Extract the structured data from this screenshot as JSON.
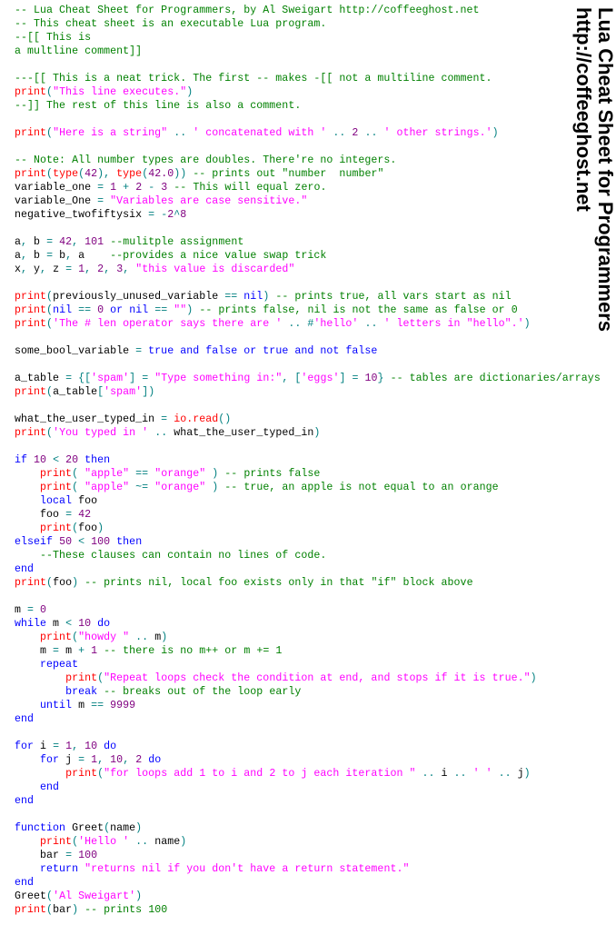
{
  "title": {
    "line1": "Lua Cheat Sheet for Programmers",
    "line2": "http://coffeeghost.net"
  },
  "colors": {
    "comment": "#008000",
    "keyword": "#0000ff",
    "builtin": "#ff0000",
    "string": "#ff00ff",
    "number": "#800080",
    "operator": "#008080",
    "text": "#000000"
  },
  "code_lines": [
    [
      [
        "c",
        "-- Lua Cheat Sheet for Programmers, by Al Sweigart http://coffeeghost.net"
      ]
    ],
    [
      [
        "c",
        "-- This cheat sheet is an executable Lua program."
      ]
    ],
    [
      [
        "c",
        "--[[ This is"
      ]
    ],
    [
      [
        "c",
        "a multline comment]]"
      ]
    ],
    [],
    [
      [
        "c",
        "---[[ This is a neat trick. The first -- makes -[[ not a multiline comment."
      ]
    ],
    [
      [
        "f",
        "print"
      ],
      [
        "o",
        "("
      ],
      [
        "s",
        "\"This line executes.\""
      ],
      [
        "o",
        ")"
      ]
    ],
    [
      [
        "c",
        "--]] The rest of this line is also a comment."
      ]
    ],
    [],
    [
      [
        "f",
        "print"
      ],
      [
        "o",
        "("
      ],
      [
        "s",
        "\"Here is a string\""
      ],
      [
        "o",
        " .. "
      ],
      [
        "s",
        "' concatenated with '"
      ],
      [
        "o",
        " .. "
      ],
      [
        "n",
        "2"
      ],
      [
        "o",
        " .. "
      ],
      [
        "s",
        "' other strings.'"
      ],
      [
        "o",
        ")"
      ]
    ],
    [],
    [
      [
        "c",
        "-- Note: All number types are doubles. There're no integers."
      ]
    ],
    [
      [
        "f",
        "print"
      ],
      [
        "o",
        "("
      ],
      [
        "f",
        "type"
      ],
      [
        "o",
        "("
      ],
      [
        "n",
        "42"
      ],
      [
        "o",
        "), "
      ],
      [
        "f",
        "type"
      ],
      [
        "o",
        "("
      ],
      [
        "n",
        "42.0"
      ],
      [
        "o",
        "))"
      ],
      [
        "t",
        " "
      ],
      [
        "c",
        "-- prints out \"number  number\""
      ]
    ],
    [
      [
        "t",
        "variable_one "
      ],
      [
        "o",
        "="
      ],
      [
        "t",
        " "
      ],
      [
        "n",
        "1"
      ],
      [
        "t",
        " "
      ],
      [
        "o",
        "+"
      ],
      [
        "t",
        " "
      ],
      [
        "n",
        "2"
      ],
      [
        "t",
        " "
      ],
      [
        "o",
        "-"
      ],
      [
        "t",
        " "
      ],
      [
        "n",
        "3"
      ],
      [
        "t",
        " "
      ],
      [
        "c",
        "-- This will equal zero."
      ]
    ],
    [
      [
        "t",
        "variable_One "
      ],
      [
        "o",
        "="
      ],
      [
        "t",
        " "
      ],
      [
        "s",
        "\"Variables are case sensitive.\""
      ]
    ],
    [
      [
        "t",
        "negative_twofiftysix "
      ],
      [
        "o",
        "="
      ],
      [
        "t",
        " "
      ],
      [
        "o",
        "-"
      ],
      [
        "n",
        "2"
      ],
      [
        "o",
        "^"
      ],
      [
        "n",
        "8"
      ]
    ],
    [],
    [
      [
        "t",
        "a"
      ],
      [
        "o",
        ","
      ],
      [
        "t",
        " b "
      ],
      [
        "o",
        "="
      ],
      [
        "t",
        " "
      ],
      [
        "n",
        "42"
      ],
      [
        "o",
        ","
      ],
      [
        "t",
        " "
      ],
      [
        "n",
        "101"
      ],
      [
        "t",
        " "
      ],
      [
        "c",
        "--mulitple assignment"
      ]
    ],
    [
      [
        "t",
        "a"
      ],
      [
        "o",
        ","
      ],
      [
        "t",
        " b "
      ],
      [
        "o",
        "="
      ],
      [
        "t",
        " b"
      ],
      [
        "o",
        ","
      ],
      [
        "t",
        " a    "
      ],
      [
        "c",
        "--provides a nice value swap trick"
      ]
    ],
    [
      [
        "t",
        "x"
      ],
      [
        "o",
        ","
      ],
      [
        "t",
        " y"
      ],
      [
        "o",
        ","
      ],
      [
        "t",
        " z "
      ],
      [
        "o",
        "="
      ],
      [
        "t",
        " "
      ],
      [
        "n",
        "1"
      ],
      [
        "o",
        ","
      ],
      [
        "t",
        " "
      ],
      [
        "n",
        "2"
      ],
      [
        "o",
        ","
      ],
      [
        "t",
        " "
      ],
      [
        "n",
        "3"
      ],
      [
        "o",
        ","
      ],
      [
        "t",
        " "
      ],
      [
        "s",
        "\"this value is discarded\""
      ]
    ],
    [],
    [
      [
        "f",
        "print"
      ],
      [
        "o",
        "("
      ],
      [
        "t",
        "previously_unused_variable "
      ],
      [
        "o",
        "=="
      ],
      [
        "t",
        " "
      ],
      [
        "k",
        "nil"
      ],
      [
        "o",
        ")"
      ],
      [
        "t",
        " "
      ],
      [
        "c",
        "-- prints true, all vars start as nil"
      ]
    ],
    [
      [
        "f",
        "print"
      ],
      [
        "o",
        "("
      ],
      [
        "k",
        "nil"
      ],
      [
        "t",
        " "
      ],
      [
        "o",
        "=="
      ],
      [
        "t",
        " "
      ],
      [
        "n",
        "0"
      ],
      [
        "t",
        " "
      ],
      [
        "k",
        "or"
      ],
      [
        "t",
        " "
      ],
      [
        "k",
        "nil"
      ],
      [
        "t",
        " "
      ],
      [
        "o",
        "=="
      ],
      [
        "t",
        " "
      ],
      [
        "s",
        "\"\""
      ],
      [
        "o",
        ")"
      ],
      [
        "t",
        " "
      ],
      [
        "c",
        "-- prints false, nil is not the same as false or 0"
      ]
    ],
    [
      [
        "f",
        "print"
      ],
      [
        "o",
        "("
      ],
      [
        "s",
        "'The # len operator says there are '"
      ],
      [
        "o",
        " .. #"
      ],
      [
        "s",
        "'hello'"
      ],
      [
        "o",
        " .. "
      ],
      [
        "s",
        "' letters in \"hello\".'"
      ],
      [
        "o",
        ")"
      ]
    ],
    [],
    [
      [
        "t",
        "some_bool_variable "
      ],
      [
        "o",
        "="
      ],
      [
        "t",
        " "
      ],
      [
        "k",
        "true and false or true and not false"
      ]
    ],
    [],
    [
      [
        "t",
        "a_table "
      ],
      [
        "o",
        "="
      ],
      [
        "t",
        " "
      ],
      [
        "o",
        "{["
      ],
      [
        "s",
        "'spam'"
      ],
      [
        "o",
        "]"
      ],
      [
        "t",
        " "
      ],
      [
        "o",
        "="
      ],
      [
        "t",
        " "
      ],
      [
        "s",
        "\"Type something in:\""
      ],
      [
        "o",
        ","
      ],
      [
        "t",
        " "
      ],
      [
        "o",
        "["
      ],
      [
        "s",
        "'eggs'"
      ],
      [
        "o",
        "]"
      ],
      [
        "t",
        " "
      ],
      [
        "o",
        "="
      ],
      [
        "t",
        " "
      ],
      [
        "n",
        "10"
      ],
      [
        "o",
        "}"
      ],
      [
        "t",
        " "
      ],
      [
        "c",
        "-- tables are dictionaries/arrays"
      ]
    ],
    [
      [
        "f",
        "print"
      ],
      [
        "o",
        "("
      ],
      [
        "t",
        "a_table"
      ],
      [
        "o",
        "["
      ],
      [
        "s",
        "'spam'"
      ],
      [
        "o",
        "])"
      ]
    ],
    [],
    [
      [
        "t",
        "what_the_user_typed_in "
      ],
      [
        "o",
        "="
      ],
      [
        "t",
        " "
      ],
      [
        "f",
        "io.read"
      ],
      [
        "o",
        "()"
      ]
    ],
    [
      [
        "f",
        "print"
      ],
      [
        "o",
        "("
      ],
      [
        "s",
        "'You typed in '"
      ],
      [
        "o",
        " .. "
      ],
      [
        "t",
        "what_the_user_typed_in"
      ],
      [
        "o",
        ")"
      ]
    ],
    [],
    [
      [
        "k",
        "if"
      ],
      [
        "t",
        " "
      ],
      [
        "n",
        "10"
      ],
      [
        "t",
        " "
      ],
      [
        "o",
        "<"
      ],
      [
        "t",
        " "
      ],
      [
        "n",
        "20"
      ],
      [
        "t",
        " "
      ],
      [
        "k",
        "then"
      ]
    ],
    [
      [
        "t",
        "    "
      ],
      [
        "f",
        "print"
      ],
      [
        "o",
        "( "
      ],
      [
        "s",
        "\"apple\""
      ],
      [
        "t",
        " "
      ],
      [
        "o",
        "=="
      ],
      [
        "t",
        " "
      ],
      [
        "s",
        "\"orange\""
      ],
      [
        "o",
        " )"
      ],
      [
        "t",
        " "
      ],
      [
        "c",
        "-- prints false"
      ]
    ],
    [
      [
        "t",
        "    "
      ],
      [
        "f",
        "print"
      ],
      [
        "o",
        "( "
      ],
      [
        "s",
        "\"apple\""
      ],
      [
        "t",
        " "
      ],
      [
        "o",
        "~="
      ],
      [
        "t",
        " "
      ],
      [
        "s",
        "\"orange\""
      ],
      [
        "o",
        " )"
      ],
      [
        "t",
        " "
      ],
      [
        "c",
        "-- true, an apple is not equal to an orange"
      ]
    ],
    [
      [
        "t",
        "    "
      ],
      [
        "k",
        "local"
      ],
      [
        "t",
        " foo"
      ]
    ],
    [
      [
        "t",
        "    foo "
      ],
      [
        "o",
        "="
      ],
      [
        "t",
        " "
      ],
      [
        "n",
        "42"
      ]
    ],
    [
      [
        "t",
        "    "
      ],
      [
        "f",
        "print"
      ],
      [
        "o",
        "("
      ],
      [
        "t",
        "foo"
      ],
      [
        "o",
        ")"
      ]
    ],
    [
      [
        "k",
        "elseif"
      ],
      [
        "t",
        " "
      ],
      [
        "n",
        "50"
      ],
      [
        "t",
        " "
      ],
      [
        "o",
        "<"
      ],
      [
        "t",
        " "
      ],
      [
        "n",
        "100"
      ],
      [
        "t",
        " "
      ],
      [
        "k",
        "then"
      ]
    ],
    [
      [
        "t",
        "    "
      ],
      [
        "c",
        "--These clauses can contain no lines of code."
      ]
    ],
    [
      [
        "k",
        "end"
      ]
    ],
    [
      [
        "f",
        "print"
      ],
      [
        "o",
        "("
      ],
      [
        "t",
        "foo"
      ],
      [
        "o",
        ")"
      ],
      [
        "t",
        " "
      ],
      [
        "c",
        "-- prints nil, local foo exists only in that \"if\" block above"
      ]
    ],
    [],
    [
      [
        "t",
        "m "
      ],
      [
        "o",
        "="
      ],
      [
        "t",
        " "
      ],
      [
        "n",
        "0"
      ]
    ],
    [
      [
        "k",
        "while"
      ],
      [
        "t",
        " m "
      ],
      [
        "o",
        "<"
      ],
      [
        "t",
        " "
      ],
      [
        "n",
        "10"
      ],
      [
        "t",
        " "
      ],
      [
        "k",
        "do"
      ]
    ],
    [
      [
        "t",
        "    "
      ],
      [
        "f",
        "print"
      ],
      [
        "o",
        "("
      ],
      [
        "s",
        "\"howdy \""
      ],
      [
        "o",
        " .. "
      ],
      [
        "t",
        "m"
      ],
      [
        "o",
        ")"
      ]
    ],
    [
      [
        "t",
        "    m "
      ],
      [
        "o",
        "="
      ],
      [
        "t",
        " m "
      ],
      [
        "o",
        "+"
      ],
      [
        "t",
        " "
      ],
      [
        "n",
        "1"
      ],
      [
        "t",
        " "
      ],
      [
        "c",
        "-- there is no m++ or m += 1"
      ]
    ],
    [
      [
        "t",
        "    "
      ],
      [
        "k",
        "repeat"
      ]
    ],
    [
      [
        "t",
        "        "
      ],
      [
        "f",
        "print"
      ],
      [
        "o",
        "("
      ],
      [
        "s",
        "\"Repeat loops check the condition at end, and stops if it is true.\""
      ],
      [
        "o",
        ")"
      ]
    ],
    [
      [
        "t",
        "        "
      ],
      [
        "k",
        "break"
      ],
      [
        "t",
        " "
      ],
      [
        "c",
        "-- breaks out of the loop early"
      ]
    ],
    [
      [
        "t",
        "    "
      ],
      [
        "k",
        "until"
      ],
      [
        "t",
        " m "
      ],
      [
        "o",
        "=="
      ],
      [
        "t",
        " "
      ],
      [
        "n",
        "9999"
      ]
    ],
    [
      [
        "k",
        "end"
      ]
    ],
    [],
    [
      [
        "k",
        "for"
      ],
      [
        "t",
        " i "
      ],
      [
        "o",
        "="
      ],
      [
        "t",
        " "
      ],
      [
        "n",
        "1"
      ],
      [
        "o",
        ","
      ],
      [
        "t",
        " "
      ],
      [
        "n",
        "10"
      ],
      [
        "t",
        " "
      ],
      [
        "k",
        "do"
      ]
    ],
    [
      [
        "t",
        "    "
      ],
      [
        "k",
        "for"
      ],
      [
        "t",
        " j "
      ],
      [
        "o",
        "="
      ],
      [
        "t",
        " "
      ],
      [
        "n",
        "1"
      ],
      [
        "o",
        ","
      ],
      [
        "t",
        " "
      ],
      [
        "n",
        "10"
      ],
      [
        "o",
        ","
      ],
      [
        "t",
        " "
      ],
      [
        "n",
        "2"
      ],
      [
        "t",
        " "
      ],
      [
        "k",
        "do"
      ]
    ],
    [
      [
        "t",
        "        "
      ],
      [
        "f",
        "print"
      ],
      [
        "o",
        "("
      ],
      [
        "s",
        "\"for loops add 1 to i and 2 to j each iteration \""
      ],
      [
        "o",
        " .. "
      ],
      [
        "t",
        "i"
      ],
      [
        "o",
        " .. "
      ],
      [
        "s",
        "' '"
      ],
      [
        "o",
        " .. "
      ],
      [
        "t",
        "j"
      ],
      [
        "o",
        ")"
      ]
    ],
    [
      [
        "t",
        "    "
      ],
      [
        "k",
        "end"
      ]
    ],
    [
      [
        "k",
        "end"
      ]
    ],
    [],
    [
      [
        "k",
        "function"
      ],
      [
        "t",
        " Greet"
      ],
      [
        "o",
        "("
      ],
      [
        "t",
        "name"
      ],
      [
        "o",
        ")"
      ]
    ],
    [
      [
        "t",
        "    "
      ],
      [
        "f",
        "print"
      ],
      [
        "o",
        "("
      ],
      [
        "s",
        "'Hello '"
      ],
      [
        "o",
        " .. "
      ],
      [
        "t",
        "name"
      ],
      [
        "o",
        ")"
      ]
    ],
    [
      [
        "t",
        "    bar "
      ],
      [
        "o",
        "="
      ],
      [
        "t",
        " "
      ],
      [
        "n",
        "100"
      ]
    ],
    [
      [
        "t",
        "    "
      ],
      [
        "k",
        "return"
      ],
      [
        "t",
        " "
      ],
      [
        "s",
        "\"returns nil if you don't have a return statement.\""
      ]
    ],
    [
      [
        "k",
        "end"
      ]
    ],
    [
      [
        "t",
        "Greet"
      ],
      [
        "o",
        "("
      ],
      [
        "s",
        "'Al Sweigart'"
      ],
      [
        "o",
        ")"
      ]
    ],
    [
      [
        "f",
        "print"
      ],
      [
        "o",
        "("
      ],
      [
        "t",
        "bar"
      ],
      [
        "o",
        ")"
      ],
      [
        "t",
        " "
      ],
      [
        "c",
        "-- prints 100"
      ]
    ]
  ]
}
